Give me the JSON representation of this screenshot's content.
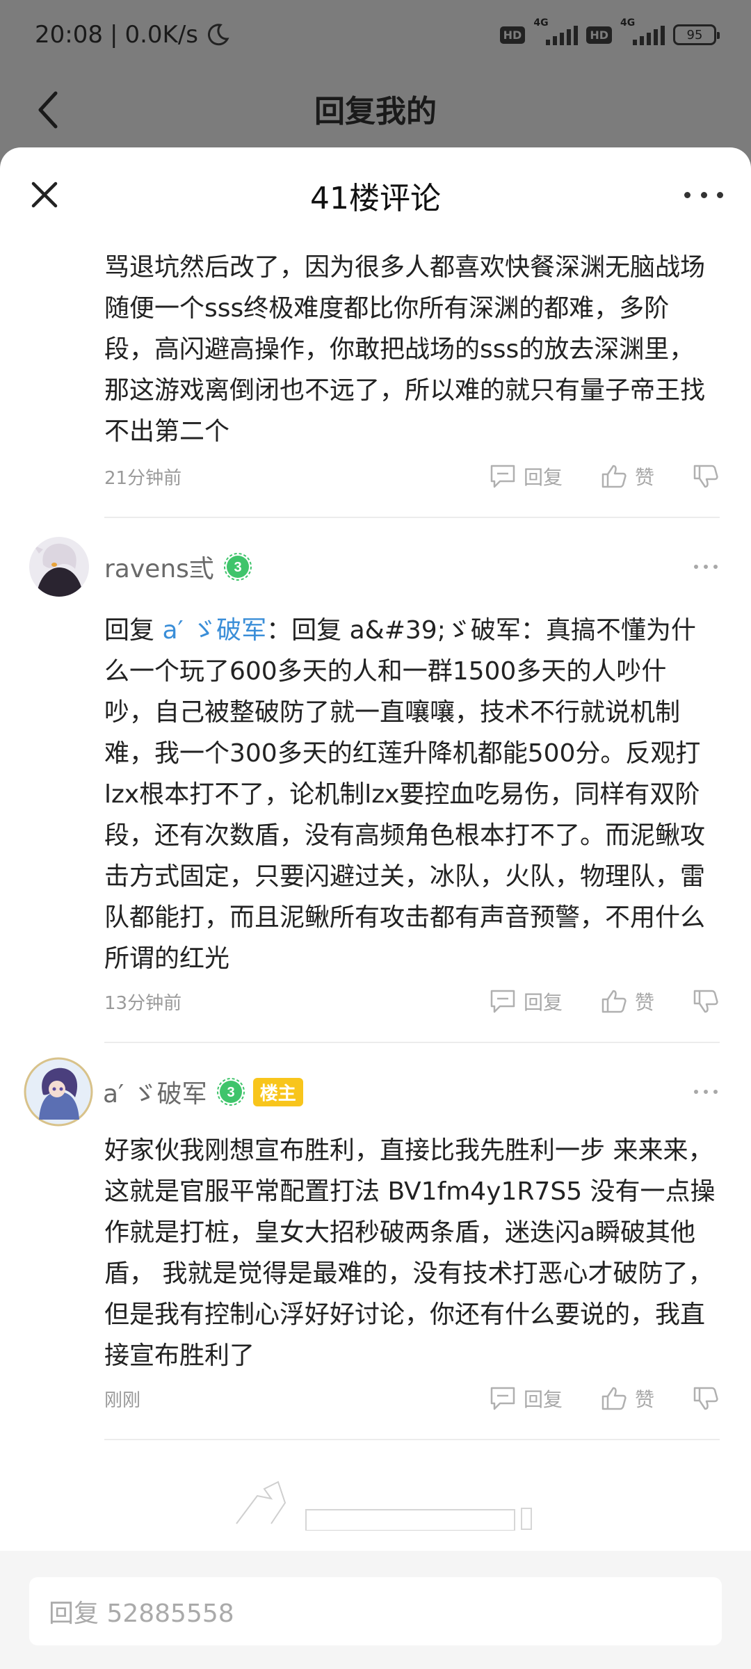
{
  "status_bar": {
    "time": "20:08",
    "speed": "0.0K/s",
    "hd1": "HD",
    "hd2": "HD",
    "net1": "4G",
    "net2": "4G",
    "battery": "95"
  },
  "back_header": {
    "title": "回复我的"
  },
  "sheet": {
    "title": "41楼评论"
  },
  "partial_comment": {
    "text": "骂退坑然后改了，因为很多人都喜欢快餐深渊无脑战场随便一个sss终极难度都比你所有深渊的都难，多阶段，高闪避高操作，你敢把战场的sss的放去深渊里，那这游戏离倒闭也不远了，所以难的就只有量子帝王找不出第二个",
    "time": "21分钟前",
    "reply_label": "回复",
    "like_label": "赞"
  },
  "comments": [
    {
      "username": "ravens弎",
      "level": "3",
      "reply_prefix": "回复 ",
      "mention": "a′ ゞ破军",
      "text": "：回复 a&#39;ゞ破军：真搞不懂为什么一个玩了600多天的人和一群1500多天的人吵什吵，自己被整破防了就一直嚷嚷，技术不行就说机制难，我一个300多天的红莲升降机都能500分。反观打lzx根本打不了，论机制lzx要控血吃易伤，同样有双阶段，还有次数盾，没有高频角色根本打不了。而泥鳅攻击方式固定，只要闪避过关，冰队，火队，物理队，雷队都能打，而且泥鳅所有攻击都有声音预警，不用什么所谓的红光",
      "time": "13分钟前",
      "reply_label": "回复",
      "like_label": "赞"
    },
    {
      "username": "a′ ゞ破军",
      "level": "3",
      "badge": "楼主",
      "text": "好家伙我刚想宣布胜利，直接比我先胜利一步 来来来，这就是官服平常配置打法 BV1fm4y1R7S5 没有一点操作就是打桩，皇女大招秒破两条盾，迷迭闪a瞬破其他盾， 我就是觉得是最难的，没有技术打恶心才破防了，但是我有控制心浮好好讨论，你还有什么要说的，我直接宣布胜利了",
      "time": "刚刚",
      "reply_label": "回复",
      "like_label": "赞"
    }
  ],
  "input": {
    "placeholder": "回复 52885558"
  },
  "colors": {
    "mention": "#3a8ed8",
    "level_badge": "#3fc46b",
    "owner_badge": "#f8c51c"
  }
}
